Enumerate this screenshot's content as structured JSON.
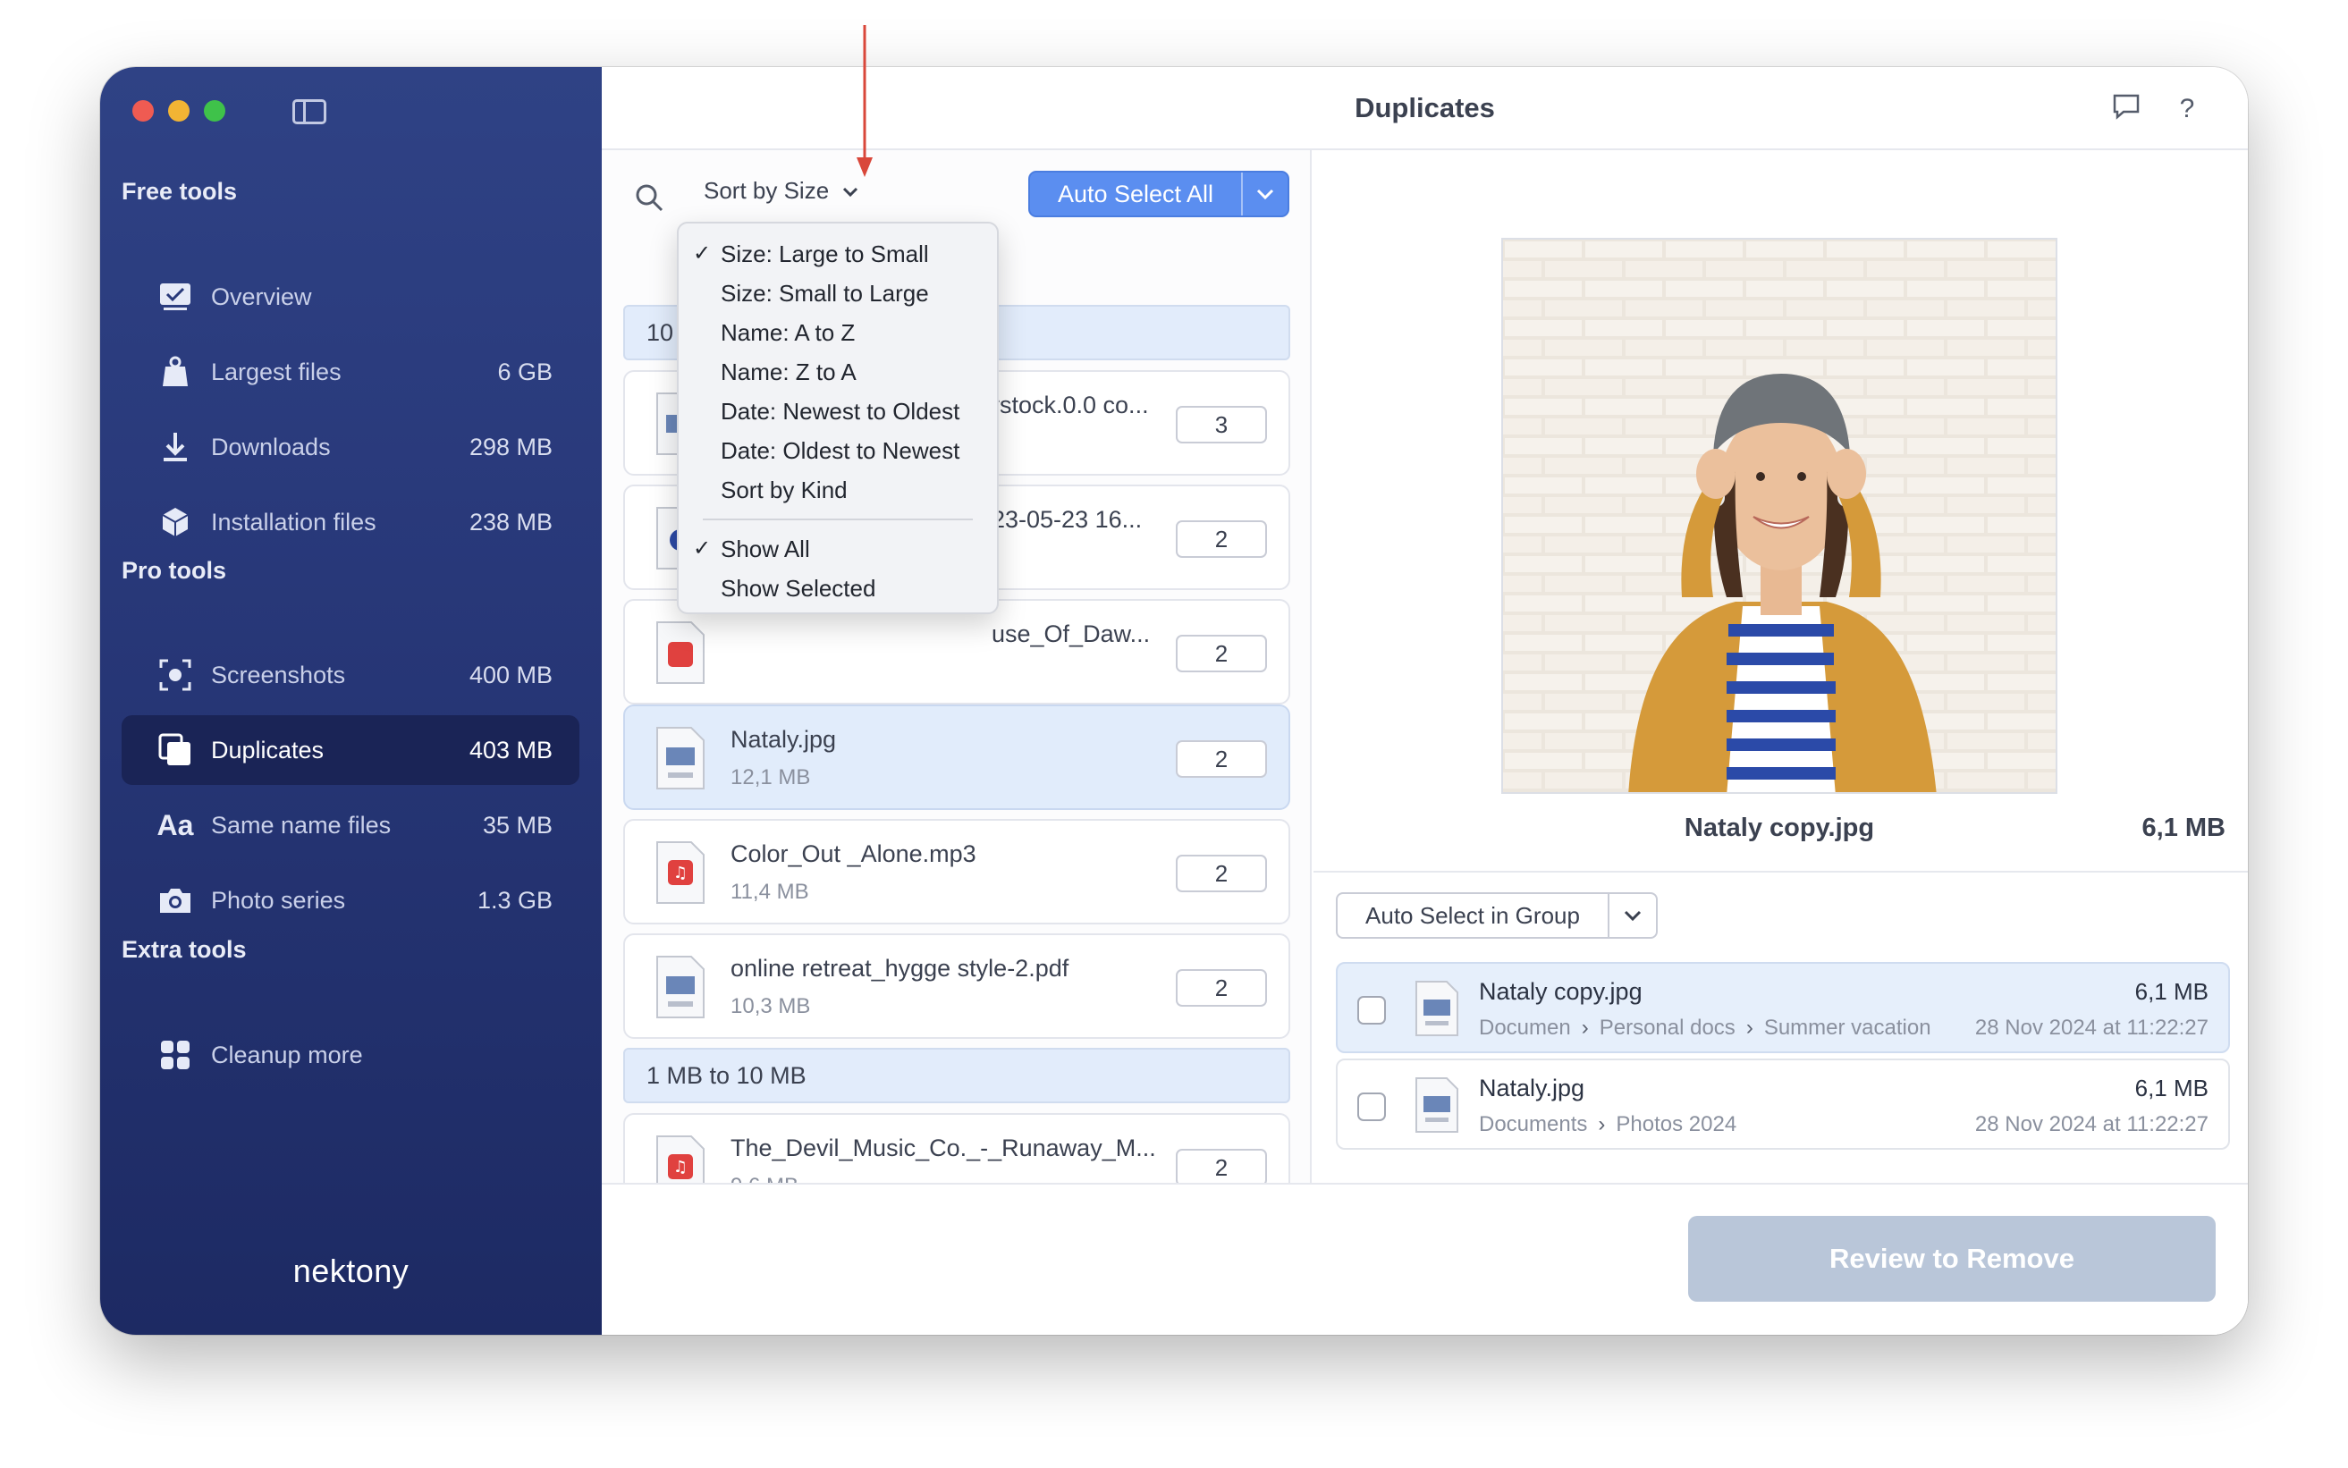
{
  "window": {
    "title": "Duplicates"
  },
  "brand": {
    "accent": "#5b8ef0",
    "sidebar_bg": "#283879",
    "selected_row": "#e1ecfb"
  },
  "sidebar": {
    "brand_logo": "nektony",
    "sections": {
      "free": "Free tools",
      "pro": "Pro tools",
      "extra": "Extra tools"
    },
    "items": [
      {
        "label": "Overview",
        "size": "",
        "icon": "monitor-icon"
      },
      {
        "label": "Largest files",
        "size": "6 GB",
        "icon": "weight-icon"
      },
      {
        "label": "Downloads",
        "size": "298 MB",
        "icon": "download-icon"
      },
      {
        "label": "Installation files",
        "size": "238 MB",
        "icon": "package-icon"
      },
      {
        "label": "Screenshots",
        "size": "400 MB",
        "icon": "screenshot-icon"
      },
      {
        "label": "Duplicates",
        "size": "403 MB",
        "icon": "duplicates-icon"
      },
      {
        "label": "Same name files",
        "size": "35 MB",
        "icon": "text-aa-icon"
      },
      {
        "label": "Photo series",
        "size": "1.3 GB",
        "icon": "camera-icon"
      },
      {
        "label": "Cleanup more",
        "size": "",
        "icon": "grid-icon"
      }
    ]
  },
  "toolbar": {
    "sort_label": "Sort by Size",
    "auto_select_all": "Auto Select All"
  },
  "list": {
    "group1_header": "10",
    "group2_header": "1 MB to 10 MB",
    "rows": [
      {
        "name": "rstock.0.0 co...",
        "size": "",
        "count": "3",
        "type": "JPEG"
      },
      {
        "name": "23-05-23 16...",
        "size": "",
        "count": "2",
        "type": ""
      },
      {
        "name": "use_Of_Daw...",
        "size": "",
        "count": "2",
        "type": "MP3"
      },
      {
        "name": "Nataly.jpg",
        "size": "12,1 MB",
        "count": "2",
        "type": "JPEG"
      },
      {
        "name": "Color_Out _Alone.mp3",
        "size": "11,4 MB",
        "count": "2",
        "type": "MP3"
      },
      {
        "name": "online retreat_hygge style-2.pdf",
        "size": "10,3 MB",
        "count": "2",
        "type": "PDF"
      },
      {
        "name": "The_Devil_Music_Co._-_Runaway_M...",
        "size": "9,6 MB",
        "count": "2",
        "type": "MP3"
      }
    ]
  },
  "sort_menu": {
    "items": [
      {
        "label": "Size: Large to Small",
        "checked": true
      },
      {
        "label": "Size: Small to Large",
        "checked": false
      },
      {
        "label": "Name: A to Z",
        "checked": false
      },
      {
        "label": "Name: Z to A",
        "checked": false
      },
      {
        "label": "Date: Newest to Oldest",
        "checked": false
      },
      {
        "label": "Date: Oldest to Newest",
        "checked": false
      },
      {
        "label": "Sort by Kind",
        "checked": false
      }
    ],
    "filter_items": [
      {
        "label": "Show All",
        "checked": true
      },
      {
        "label": "Show Selected",
        "checked": false
      }
    ],
    "check_glyph": "✓"
  },
  "preview": {
    "name": "Nataly copy.jpg",
    "size": "6,1 MB",
    "auto_select_group": "Auto Select in Group",
    "copies": [
      {
        "name": "Nataly copy.jpg",
        "size": "6,1 MB",
        "path": [
          "Documen",
          "Personal docs",
          "Summer vacation"
        ],
        "date": "28 Nov 2024 at 11:22:27",
        "type": "JPEG"
      },
      {
        "name": "Nataly.jpg",
        "size": "6,1 MB",
        "path": [
          "Documents",
          "Photos 2024"
        ],
        "date": "28 Nov 2024 at 11:22:27",
        "type": "JPEG"
      }
    ]
  },
  "footer": {
    "review_button": "Review to Remove"
  }
}
